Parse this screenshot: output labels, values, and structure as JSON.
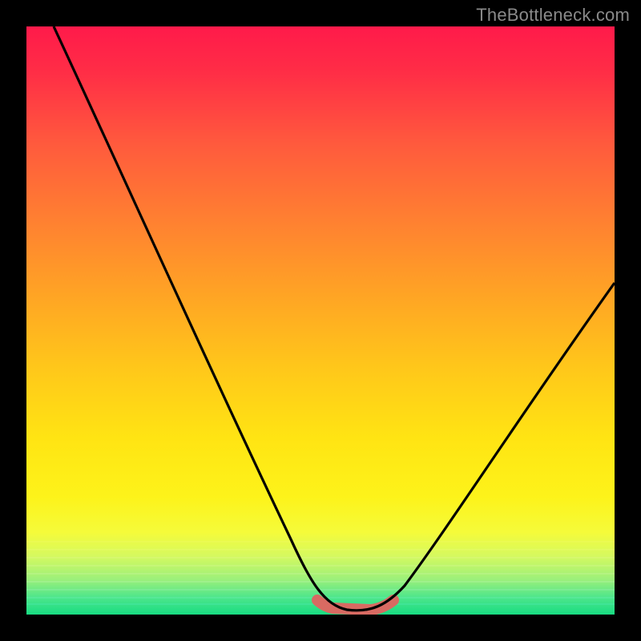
{
  "watermark": "TheBottleneck.com",
  "colors": {
    "background": "#000000",
    "curve": "#000000",
    "valley_highlight": "#d86a62",
    "gradient_top": "#ff1a4a",
    "gradient_bottom": "#18dc82"
  },
  "chart_data": {
    "type": "line",
    "title": "",
    "xlabel": "",
    "ylabel": "",
    "xlim": [
      0,
      100
    ],
    "ylim": [
      0,
      100
    ],
    "grid": false,
    "legend": null,
    "annotations": [
      "TheBottleneck.com"
    ],
    "background": "vertical red-to-green gradient",
    "series": [
      {
        "name": "bottleneck-curve",
        "x": [
          0,
          5,
          10,
          15,
          20,
          25,
          30,
          35,
          40,
          45,
          48,
          50,
          52,
          54,
          56,
          58,
          60,
          62,
          65,
          70,
          75,
          80,
          85,
          90,
          95,
          100
        ],
        "y": [
          100,
          90,
          80,
          70,
          60,
          50,
          40,
          30,
          20,
          10,
          5,
          2,
          1,
          0,
          0,
          0,
          1,
          2,
          5,
          12,
          20,
          28,
          36,
          44,
          51,
          58
        ]
      },
      {
        "name": "valley-highlight",
        "x": [
          50,
          52,
          54,
          56,
          58,
          60,
          62
        ],
        "y": [
          2,
          1,
          0,
          0,
          0,
          1,
          2
        ]
      }
    ]
  }
}
